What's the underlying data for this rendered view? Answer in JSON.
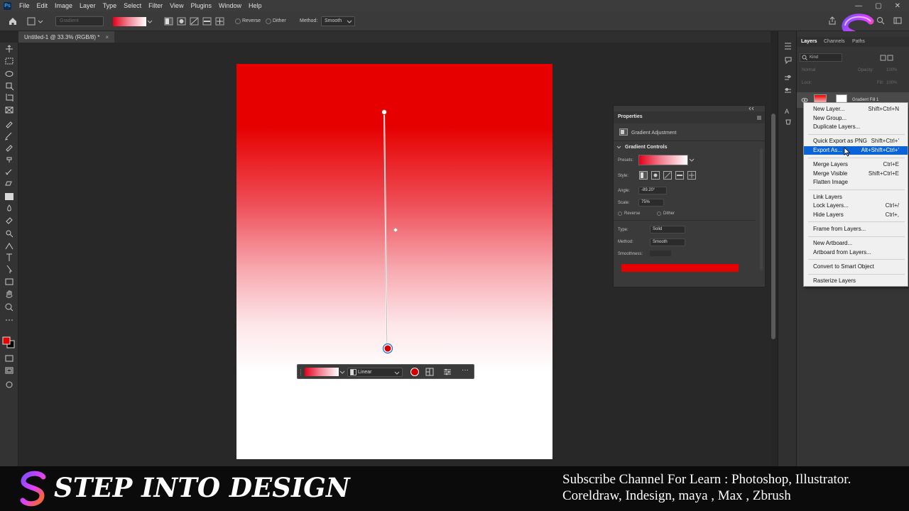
{
  "app": {
    "menu": [
      "File",
      "Edit",
      "Image",
      "Layer",
      "Type",
      "Select",
      "Filter",
      "View",
      "Plugins",
      "Window",
      "Help"
    ],
    "window_controls": [
      "—",
      "▢",
      "✕"
    ]
  },
  "options_bar": {
    "gradient_label": "Gradient",
    "reverse_label": "Reverse",
    "dither_label": "Dither",
    "method_label": "Method:",
    "method_value": "Smooth"
  },
  "document": {
    "tab_title": "Untitled-1 @ 33.3% (RGB/8) *",
    "tab_close": "×"
  },
  "contextual_taskbar": {
    "style_value": "Linear",
    "stop_color": "#d40000",
    "more": "···"
  },
  "properties_panel": {
    "title": "Properties",
    "adjustment_label": "Gradient Adjustment",
    "section_title": "Gradient Controls",
    "presets_label": "Presets:",
    "style_label": "Style:",
    "angle_label": "Angle:",
    "angle_value": "-89.20°",
    "scale_label": "Scale:",
    "scale_value": "75%",
    "reverse_label": "Reverse",
    "dither_label": "Dither",
    "type_label": "Type:",
    "type_value": "Solid",
    "method_label": "Method:",
    "method_value": "Smooth",
    "smoothness_label": "Smoothness:",
    "bar_color": "#e60000"
  },
  "layers_panel": {
    "tabs": [
      "Layers",
      "Channels",
      "Paths"
    ],
    "kind_label": "Kind",
    "blend_mode": "Normal",
    "opacity_label": "Opacity:",
    "opacity_value": "100%",
    "lock_label": "Lock:",
    "fill_label": "Fill:",
    "fill_value": "100%",
    "layer_name": "Gradient Fill 1"
  },
  "context_menu": {
    "groups": [
      [
        {
          "label": "New Layer...",
          "shortcut": "Shift+Ctrl+N"
        },
        {
          "label": "New Group...",
          "shortcut": ""
        },
        {
          "label": "Duplicate Layers...",
          "shortcut": ""
        }
      ],
      [
        {
          "label": "Quick Export as PNG",
          "shortcut": "Shift+Ctrl+'"
        },
        {
          "label": "Export As...",
          "shortcut": "Alt+Shift+Ctrl+'",
          "selected": true
        }
      ],
      [
        {
          "label": "Merge Layers",
          "shortcut": "Ctrl+E"
        },
        {
          "label": "Merge Visible",
          "shortcut": "Shift+Ctrl+E"
        },
        {
          "label": "Flatten Image",
          "shortcut": ""
        }
      ],
      [
        {
          "label": "Link Layers",
          "shortcut": ""
        },
        {
          "label": "Lock Layers...",
          "shortcut": "Ctrl+/"
        },
        {
          "label": "Hide Layers",
          "shortcut": "Ctrl+,"
        }
      ],
      [
        {
          "label": "Frame from Layers...",
          "shortcut": ""
        }
      ],
      [
        {
          "label": "New Artboard...",
          "shortcut": ""
        },
        {
          "label": "Artboard from Layers...",
          "shortcut": ""
        }
      ],
      [
        {
          "label": "Convert to Smart Object",
          "shortcut": ""
        }
      ],
      [
        {
          "label": "Rasterize Layers",
          "shortcut": ""
        }
      ]
    ]
  },
  "banner": {
    "title": "STEP INTO DESIGN",
    "subtitle_line1": "Subscribe Channel For Learn : Photoshop, Illustrator.",
    "subtitle_line2": "Coreldraw, Indesign, maya , Max , Zbrush"
  },
  "colors": {
    "foreground": "#e60000",
    "background": "#000000",
    "accent_selection": "#0a64d8"
  }
}
